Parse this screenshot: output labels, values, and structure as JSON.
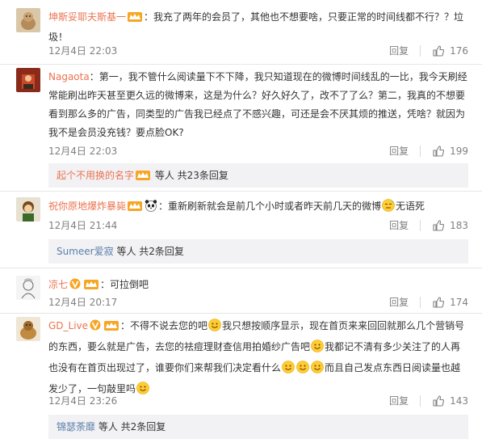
{
  "comments": [
    {
      "user": "坤斯妥耶夫斯基一",
      "text_parts": [
        "：我充了两年的会员了，其他也不想要啥，只要正常的时间线都不行？？垃",
        "圾！"
      ],
      "time": "12月4日 22:03",
      "reply": "回复",
      "likes": "176"
    },
    {
      "user": "Nagaota",
      "text_parts": [
        "：第一，我不管什么阅读量下不下降，我只知道现在的微博时间线乱的一比，我今天刷经",
        "常能刷出昨天甚至更久远的微博来，这是为什么？好久好久了，改不了了么？第二，我真的不想要",
        "看到那么多的广告，同类型的广告我已经点了不感兴趣，可还是会不厌其烦的推送，凭啥？就因为",
        "我不是会员没充钱？要点脸OK?"
      ],
      "time": "12月4日 22:03",
      "reply": "回复",
      "likes": "199",
      "sub": {
        "name": "起个不用换的名字",
        "text": " 等人 共23条回复"
      }
    },
    {
      "user": "祝你原地爆炸暴毙",
      "text_parts": [
        "：重新刷新就会是前几个小时或者昨天前几天的微博",
        "无语死"
      ],
      "time": "12月4日 21:44",
      "reply": "回复",
      "likes": "183",
      "sub": {
        "name": "Sumeer爱寂",
        "text": " 等人 共2条回复"
      }
    },
    {
      "user": "凉七",
      "text_parts": [
        "：可拉倒吧"
      ],
      "time": "12月4日 20:17",
      "reply": "回复",
      "likes": "174"
    },
    {
      "user": "GD_Live",
      "text_parts": [
        "：不得不说去您的吧",
        "我只想按顺序显示，现在首页来来回回就那么几个营销号",
        "的东西，要么就是广告，去您的祛痘理财查信用拍婚纱广告吧",
        "我都记不清有多少关注了的人再",
        "也没有在首页出现过了，谁要你们来帮我们决定看什么",
        "而且自己发点东西日阅读量也越",
        "发少了，一句敲里吗"
      ],
      "time": "12月4日 23:26",
      "reply": "回复",
      "likes": "143",
      "sub": {
        "name": "锦瑟荼靡",
        "text": " 等人 共2条回复"
      }
    }
  ],
  "icons": {
    "vip_badge": "vip-crown-icon",
    "verified_badge": "verified-v-icon",
    "emoji_smile": "smile-emoji-icon",
    "emoji_panda": "panda-emoji-icon",
    "emoji_sweat": "sweat-emoji-icon",
    "like": "thumbs-up-icon"
  },
  "colors": {
    "username": "#eb7350",
    "meta": "#808080",
    "subbox_bg": "#f2f2f5",
    "text": "#333333"
  }
}
